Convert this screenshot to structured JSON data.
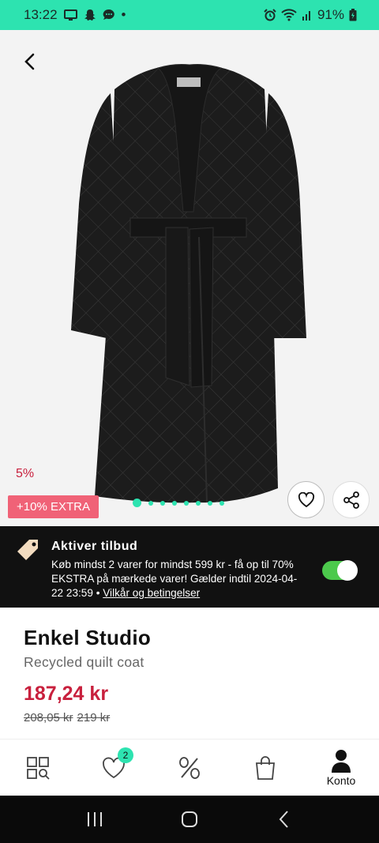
{
  "status": {
    "time": "13:22",
    "battery": "91%",
    "dot": "•"
  },
  "product": {
    "discount_pct": "5%",
    "extra_badge": "+10% EXTRA",
    "image_count": 8,
    "brand": "Enkel Studio",
    "name": "Recycled quilt coat",
    "price": "187,24 kr",
    "old_price_1": "208,05 kr",
    "old_price_2": "219 kr"
  },
  "offer": {
    "title": "Aktiver tilbud",
    "text": "Køb mindst 2 varer for mindst 599 kr - få op til 70% EKSTRA på mærkede varer! Gælder indtil 2024-04-22 23:59 • ",
    "link": "Vilkår og betingelser",
    "toggle_on": true
  },
  "nav": {
    "wishlist_count": "2",
    "account_label": "Konto"
  },
  "colors": {
    "accent": "#2de3b0",
    "price_red": "#c8203d",
    "badge_pink": "#f06277",
    "toggle_green": "#4cc94c"
  },
  "icons": [
    "back-arrow-icon",
    "heart-icon",
    "share-icon",
    "tag-icon",
    "categories-icon",
    "percent-icon",
    "bag-icon",
    "user-icon"
  ]
}
